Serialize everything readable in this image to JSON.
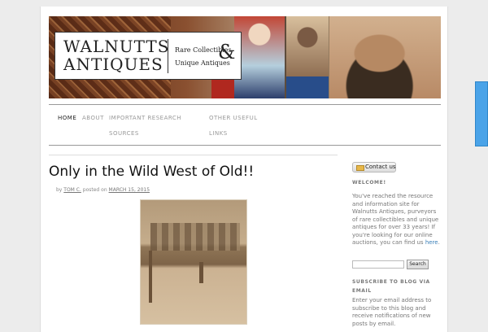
{
  "site": {
    "logo_line1": "WALNUTTS",
    "logo_line2": "ANTIQUES",
    "tagline_line1": "Rare Collectibles",
    "tagline_line2": "Unique Antiques",
    "ampersand": "&"
  },
  "nav": {
    "items": [
      {
        "label": "HOME",
        "active": true
      },
      {
        "label": "ABOUT"
      },
      {
        "label": "IMPORTANT RESEARCH"
      },
      {
        "label": "SOURCES"
      },
      {
        "label": "OTHER USEFUL"
      },
      {
        "label": "LINKS"
      }
    ]
  },
  "post": {
    "title": "Only in the Wild West of Old!!",
    "by": "by",
    "author": "TOM C.",
    "posted_on": "posted on",
    "date": "MARCH 15, 2015"
  },
  "sidebar": {
    "contact_label": "Contact us",
    "welcome_title": "WELCOME!",
    "welcome_text": "You've reached the resource and information site for Walnutts Antiques, purveyors of rare collectibles and unique antiques for over 33 years! If you're looking for our online auctions, you can find us",
    "welcome_link": "here",
    "welcome_end": ".",
    "search_button": "Search",
    "subscribe_title_1": "SUBSCRIBE TO BLOG VIA",
    "subscribe_title_2": "EMAIL",
    "subscribe_text": "Enter your email address to subscribe to this blog and receive notifications of new posts by email."
  },
  "colors": {
    "link": "#3a7fb8",
    "side_tab": "#4aa3e8"
  }
}
